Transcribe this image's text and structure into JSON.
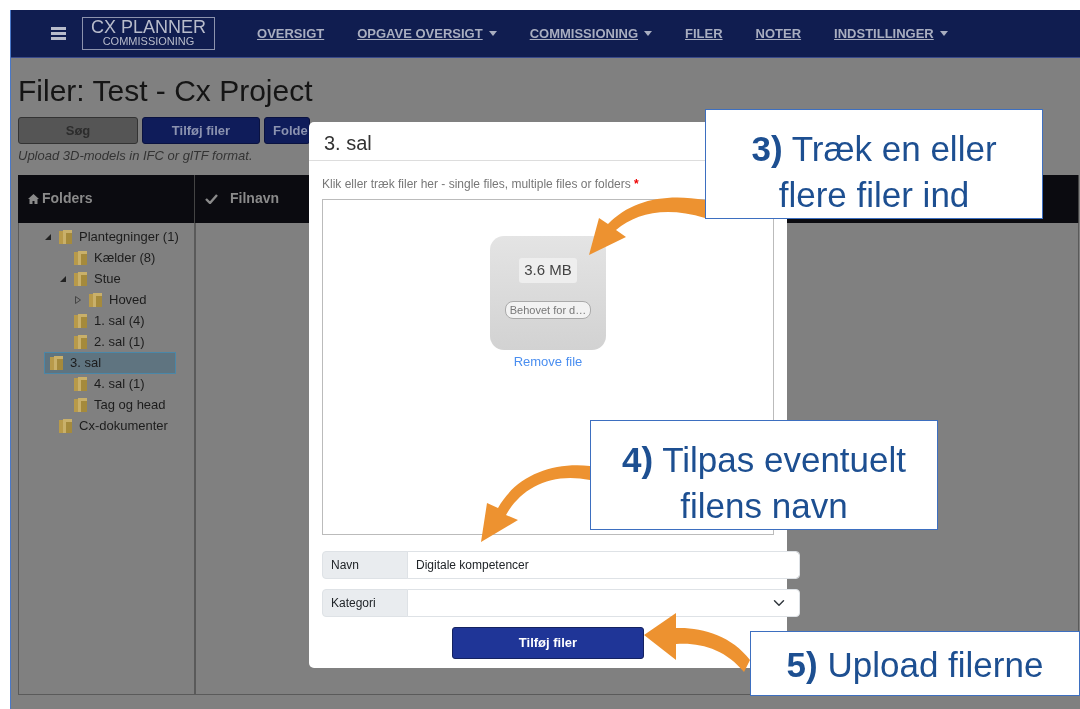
{
  "navbar": {
    "brand": {
      "title": "CX PLANNER",
      "subtitle": "COMMISSIONING"
    },
    "items": [
      {
        "label": "OVERSIGT",
        "dropdown": false
      },
      {
        "label": "OPGAVE OVERSIGT",
        "dropdown": true
      },
      {
        "label": "COMMISSIONING",
        "dropdown": true
      },
      {
        "label": "FILER",
        "dropdown": false
      },
      {
        "label": "NOTER",
        "dropdown": false
      },
      {
        "label": "INDSTILLINGER",
        "dropdown": true
      }
    ]
  },
  "page": {
    "title": "Filer: Test - Cx Project",
    "buttons": [
      {
        "label": "Søg",
        "kind": "secondary"
      },
      {
        "label": "Tilføj filer",
        "kind": "primary"
      },
      {
        "label": "Folde",
        "kind": "primary"
      }
    ],
    "hint": "Upload 3D-models in IFC or glTF format.",
    "columns": [
      "Folders",
      "Filnavn"
    ],
    "tree": [
      {
        "label": "Plantegninger (1)",
        "selected": false,
        "expanded": true,
        "children": [
          {
            "label": "Kælder (8)",
            "selected": false
          },
          {
            "label": "Stue",
            "selected": false,
            "expanded": true,
            "children": [
              {
                "label": "Hoved",
                "selected": false,
                "expanded": false
              }
            ]
          },
          {
            "label": "1. sal (4)",
            "selected": false
          },
          {
            "label": "2. sal (1)",
            "selected": false
          },
          {
            "label": "3. sal",
            "selected": true
          },
          {
            "label": "4. sal (1)",
            "selected": false
          },
          {
            "label": "Tag og head",
            "selected": false
          }
        ]
      },
      {
        "label": "Cx-dokumenter",
        "selected": false
      }
    ]
  },
  "modal": {
    "title": "3. sal",
    "drop_label": "Klik eller træk filer her - single files, multiple files or folders",
    "required": "*",
    "file": {
      "size": "3.6 MB",
      "name": "Behovet for d…",
      "remove": "Remove file"
    },
    "fields": [
      {
        "label": "Navn",
        "kind": "text",
        "value": "Digitale kompetencer"
      },
      {
        "label": "Kategori",
        "kind": "select"
      }
    ],
    "submit": "Tilføj filer"
  },
  "callouts": [
    {
      "text": "**3)** Træk en eller flere filer ind"
    },
    {
      "text": "**4)** Tilpas eventuelt filens navn"
    },
    {
      "text": "**5)** Upload filerne"
    }
  ]
}
